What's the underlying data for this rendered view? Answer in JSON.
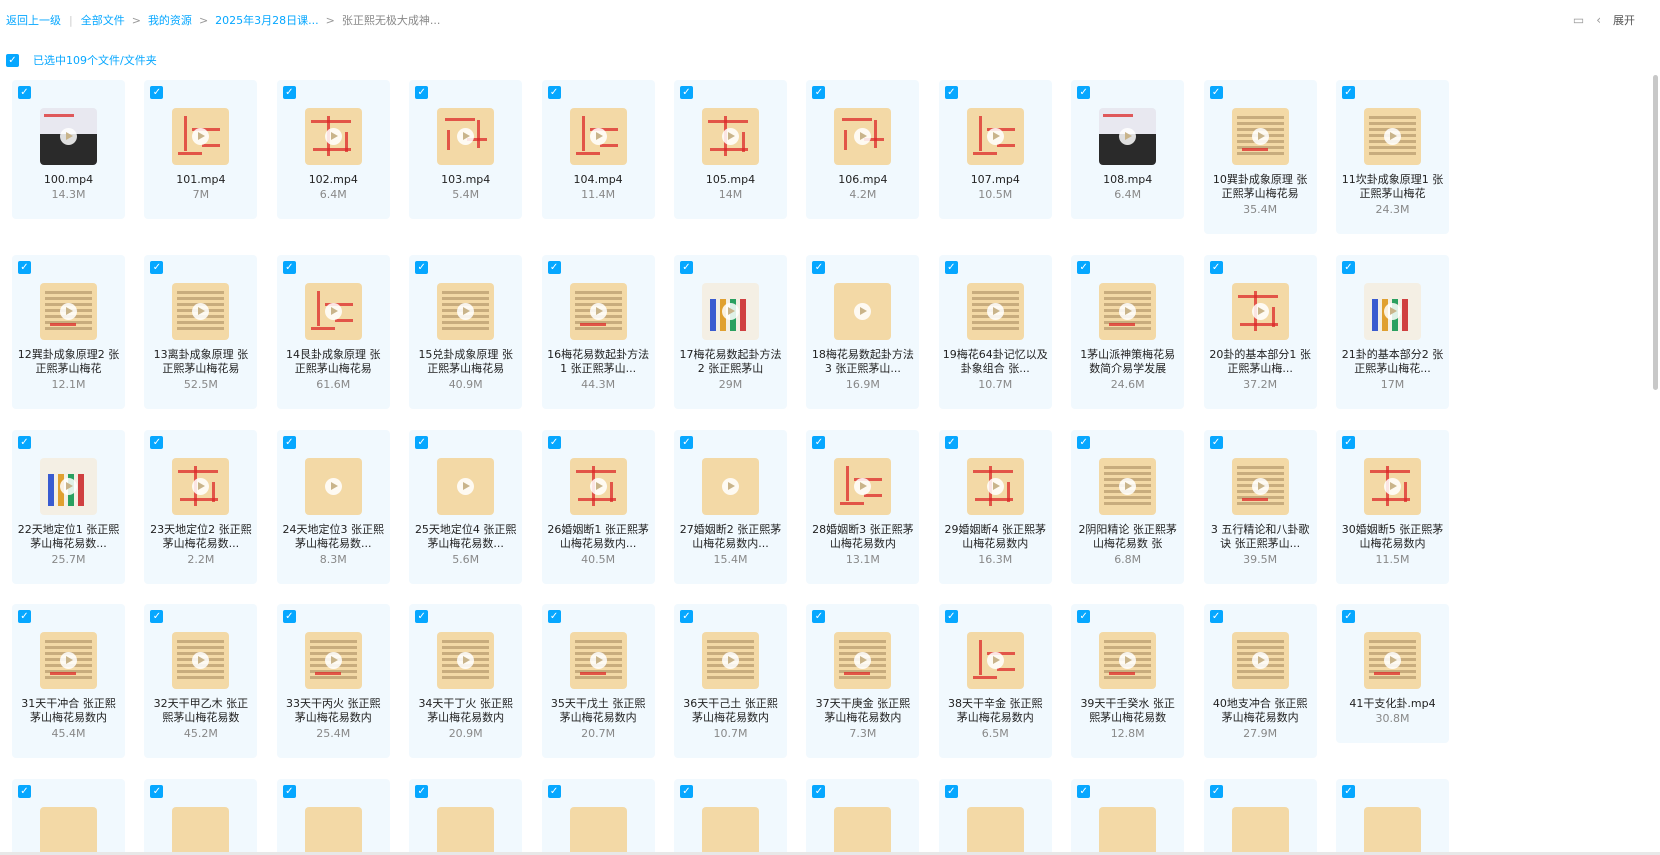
{
  "breadcrumb": {
    "back": "返回上一级",
    "items": [
      "全部文件",
      "我的资源",
      "2025年3月28日课...",
      "张正熙无极大成神..."
    ]
  },
  "toolbar": {
    "expand_label": "展开",
    "separator_char": ">"
  },
  "selection": {
    "label": "已选中109个文件/文件夹"
  },
  "colors": {
    "accent": "#06a7ff",
    "card_bg": "#f1f9fe"
  },
  "files": [
    {
      "name": "100.mp4",
      "size": "14.3M",
      "thumb": "dark"
    },
    {
      "name": "101.mp4",
      "size": "7M",
      "thumb": "red"
    },
    {
      "name": "102.mp4",
      "size": "6.4M",
      "thumb": "red"
    },
    {
      "name": "103.mp4",
      "size": "5.4M",
      "thumb": "red"
    },
    {
      "name": "104.mp4",
      "size": "11.4M",
      "thumb": "red"
    },
    {
      "name": "105.mp4",
      "size": "14M",
      "thumb": "red"
    },
    {
      "name": "106.mp4",
      "size": "4.2M",
      "thumb": "red"
    },
    {
      "name": "107.mp4",
      "size": "10.5M",
      "thumb": "red"
    },
    {
      "name": "108.mp4",
      "size": "6.4M",
      "thumb": "dark"
    },
    {
      "name": "10巽卦成象原理 张正熙茅山梅花易",
      "size": "35.4M",
      "thumb": "doc"
    },
    {
      "name": "11坎卦成象原理1 张正熙茅山梅花",
      "size": "24.3M",
      "thumb": "doc"
    },
    {
      "name": "12巽卦成象原理2 张正熙茅山梅花",
      "size": "12.1M",
      "thumb": "doc"
    },
    {
      "name": "13离卦成象原理 张正熙茅山梅花易",
      "size": "52.5M",
      "thumb": "doc"
    },
    {
      "name": "14艮卦成象原理 张正熙茅山梅花易",
      "size": "61.6M",
      "thumb": "red"
    },
    {
      "name": "15兑卦成象原理 张正熙茅山梅花易",
      "size": "40.9M",
      "thumb": "doc"
    },
    {
      "name": "16梅花易数起卦方法1 张正熙茅山...",
      "size": "44.3M",
      "thumb": "doc"
    },
    {
      "name": "17梅花易数起卦方法2 张正熙茅山",
      "size": "29M",
      "thumb": "table"
    },
    {
      "name": "18梅花易数起卦方法3 张正熙茅山...",
      "size": "16.9M",
      "thumb": "plain"
    },
    {
      "name": "19梅花64卦记忆以及卦象组合 张...",
      "size": "10.7M",
      "thumb": "doc"
    },
    {
      "name": "1茅山派神策梅花易数简介易学发展",
      "size": "24.6M",
      "thumb": "doc"
    },
    {
      "name": "20卦的基本部分1 张正熙茅山梅...",
      "size": "37.2M",
      "thumb": "red"
    },
    {
      "name": "21卦的基本部分2 张正熙茅山梅花...",
      "size": "17M",
      "thumb": "table"
    },
    {
      "name": "22天地定位1 张正熙茅山梅花易数...",
      "size": "25.7M",
      "thumb": "table"
    },
    {
      "name": "23天地定位2 张正熙茅山梅花易数...",
      "size": "2.2M",
      "thumb": "red"
    },
    {
      "name": "24天地定位3 张正熙茅山梅花易数...",
      "size": "8.3M",
      "thumb": "plain"
    },
    {
      "name": "25天地定位4 张正熙茅山梅花易数...",
      "size": "5.6M",
      "thumb": "plain"
    },
    {
      "name": "26婚姻断1 张正熙茅山梅花易数内...",
      "size": "40.5M",
      "thumb": "red"
    },
    {
      "name": "27婚姻断2 张正熙茅山梅花易数内...",
      "size": "15.4M",
      "thumb": "plain"
    },
    {
      "name": "28婚姻断3 张正熙茅山梅花易数内",
      "size": "13.1M",
      "thumb": "red"
    },
    {
      "name": "29婚姻断4 张正熙茅山梅花易数内",
      "size": "16.3M",
      "thumb": "red"
    },
    {
      "name": "2阴阳精论 张正熙茅山梅花易数 张",
      "size": "6.8M",
      "thumb": "doc"
    },
    {
      "name": "3 五行精论和八卦歌诀 张正熙茅山...",
      "size": "39.5M",
      "thumb": "doc"
    },
    {
      "name": "30婚姻断5 张正熙茅山梅花易数内",
      "size": "11.5M",
      "thumb": "red"
    },
    {
      "name": "31天干冲合 张正熙茅山梅花易数内",
      "size": "45.4M",
      "thumb": "doc"
    },
    {
      "name": "32天干甲乙木 张正熙茅山梅花易数",
      "size": "45.2M",
      "thumb": "doc"
    },
    {
      "name": "33天干丙火 张正熙茅山梅花易数内",
      "size": "25.4M",
      "thumb": "doc"
    },
    {
      "name": "34天干丁火 张正熙茅山梅花易数内",
      "size": "20.9M",
      "thumb": "doc"
    },
    {
      "name": "35天干戊土 张正熙茅山梅花易数内",
      "size": "20.7M",
      "thumb": "doc"
    },
    {
      "name": "36天干己土 张正熙茅山梅花易数内",
      "size": "10.7M",
      "thumb": "doc"
    },
    {
      "name": "37天干庚金 张正熙茅山梅花易数内",
      "size": "7.3M",
      "thumb": "doc"
    },
    {
      "name": "38天干辛金 张正熙茅山梅花易数内",
      "size": "6.5M",
      "thumb": "red"
    },
    {
      "name": "39天干壬癸水 张正熙茅山梅花易数",
      "size": "12.8M",
      "thumb": "doc"
    },
    {
      "name": "40地支冲合 张正熙茅山梅花易数内",
      "size": "27.9M",
      "thumb": "doc"
    },
    {
      "name": "41干支化卦.mp4",
      "size": "30.8M",
      "thumb": "doc"
    }
  ],
  "partial_row_count": 11
}
